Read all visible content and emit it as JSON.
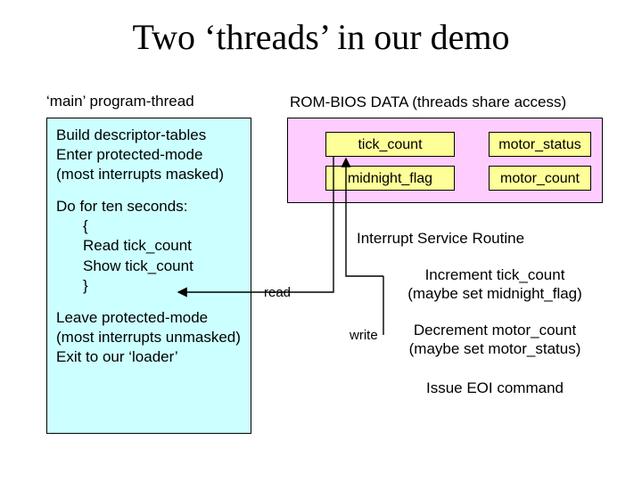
{
  "title": "Two ‘threads’ in our demo",
  "main_thread_label": "‘main’ program-thread",
  "rom_bios_label": "ROM-BIOS DATA  (threads share access)",
  "main_box": {
    "l1": "Build descriptor-tables",
    "l2": "Enter protected-mode",
    "l3": "  (most interrupts masked)",
    "l4": "Do for ten seconds:",
    "l5": "{",
    "l6": "Read tick_count",
    "l7": "Show tick_count",
    "l8": "}",
    "l9": "Leave protected-mode",
    "l10": "(most interrupts unmasked)",
    "l11": "Exit to our ‘loader’"
  },
  "cells": {
    "tick_count": "tick_count",
    "midnight_flag": "midnight_flag",
    "motor_status": "motor_status",
    "motor_count": "motor_count"
  },
  "isr": {
    "title": "Interrupt Service Routine",
    "line1a": "Increment tick_count",
    "line1b": "(maybe set midnight_flag)",
    "line2a": "Decrement motor_count",
    "line2b": "(maybe set motor_status)",
    "line3": "Issue EOI command"
  },
  "arrows": {
    "read": "read",
    "write": "write"
  }
}
